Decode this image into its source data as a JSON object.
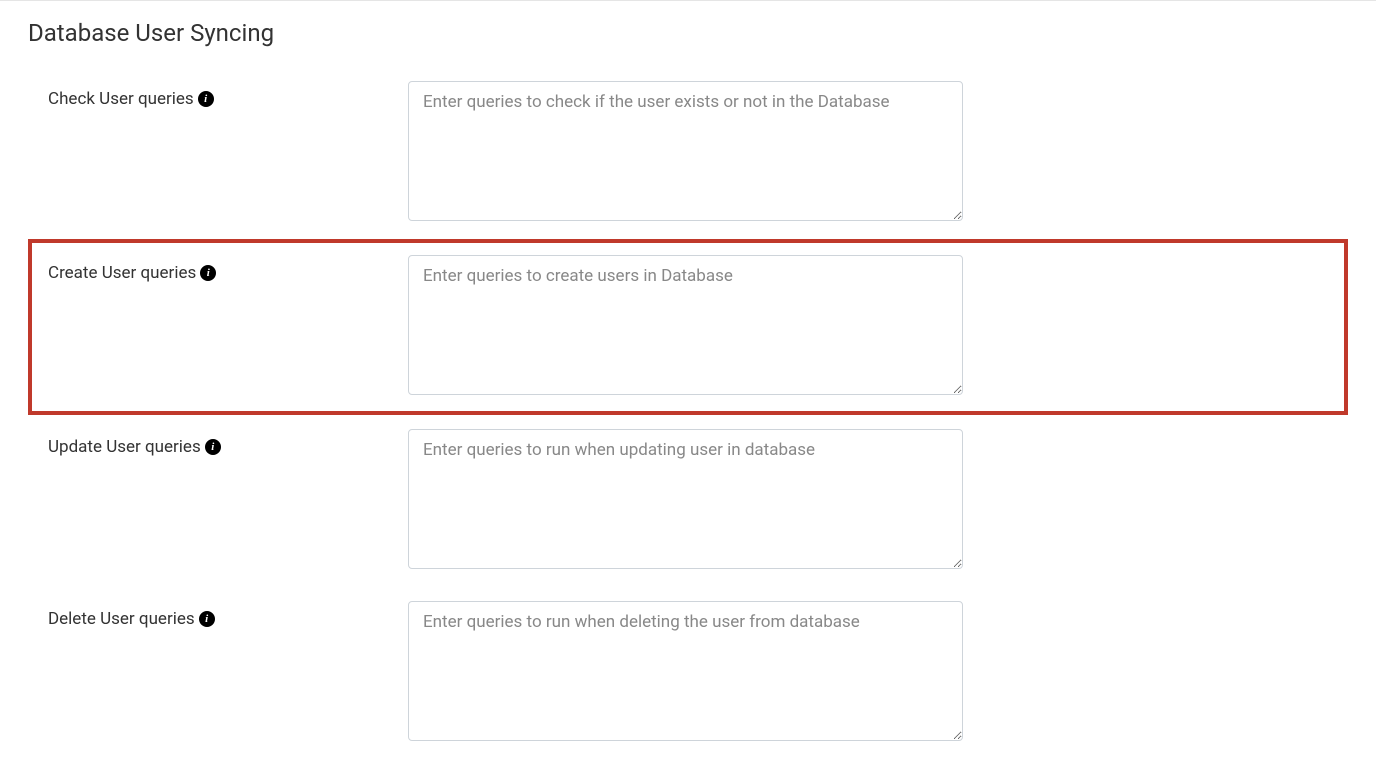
{
  "section": {
    "title": "Database User Syncing"
  },
  "fields": {
    "check": {
      "label": "Check User queries",
      "placeholder": "Enter queries to check if the user exists or not in the Database"
    },
    "create": {
      "label": "Create User queries",
      "placeholder": "Enter queries to create users in Database"
    },
    "update": {
      "label": "Update User queries",
      "placeholder": "Enter queries to run when updating user in database"
    },
    "delete": {
      "label": "Delete User queries",
      "placeholder": "Enter queries to run when deleting the user from database"
    }
  },
  "icons": {
    "info": "i"
  }
}
